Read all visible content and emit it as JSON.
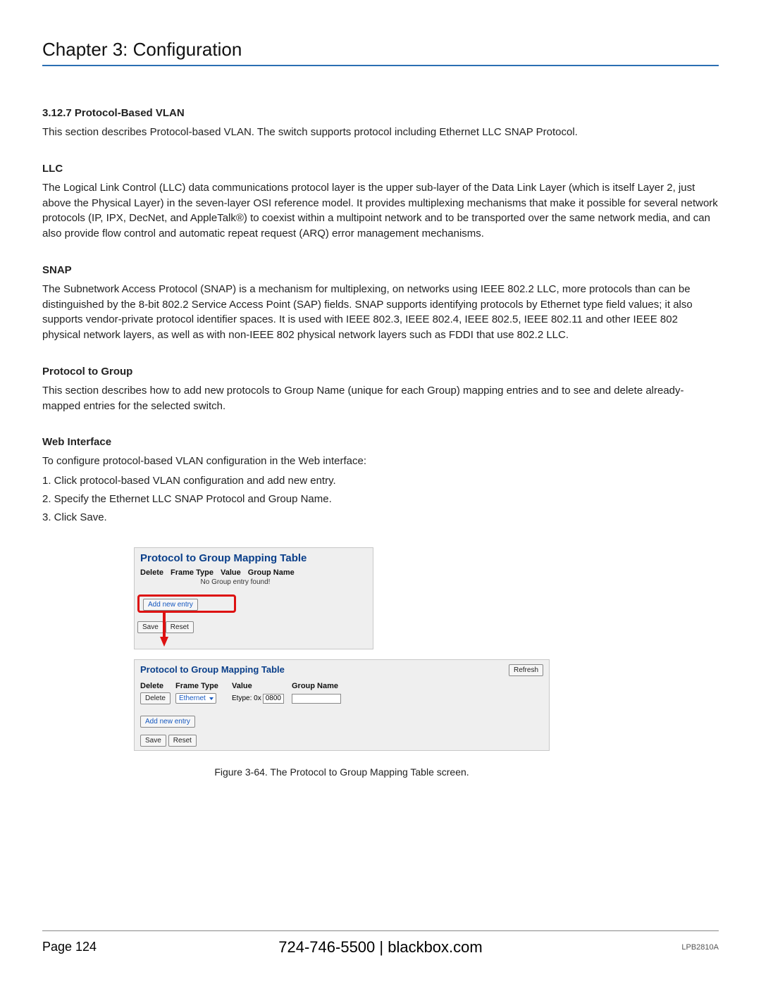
{
  "header": {
    "chapter_title": "Chapter 3: Configuration"
  },
  "s1": {
    "h": "3.12.7 Protocol-Based VLAN",
    "p": "This section describes Protocol-based VLAN. The switch supports protocol including Ethernet LLC SNAP Protocol."
  },
  "llc": {
    "h": "LLC",
    "p": "The Logical Link Control (LLC) data communications protocol layer is the upper sub-layer of the Data Link Layer (which is itself Layer 2, just above the Physical Layer) in the seven-layer OSI reference model. It provides multiplexing mechanisms that make it possible for several network protocols (IP, IPX, DecNet, and AppleTalk®) to coexist within a multipoint network and to be transported over the same network media, and can also provide flow control and automatic repeat request (ARQ) error management mechanisms."
  },
  "snap": {
    "h": "SNAP",
    "p": "The Subnetwork Access Protocol (SNAP) is a mechanism for multiplexing, on networks using IEEE 802.2 LLC, more protocols than can be distinguished by the 8-bit 802.2 Service Access Point (SAP) fields. SNAP supports identifying protocols by Ethernet type field values; it also supports vendor-private protocol identifier spaces. It is used with IEEE 802.3, IEEE 802.4, IEEE 802.5, IEEE 802.11 and other IEEE 802 physical network layers, as well as with non-IEEE 802 physical network layers such as FDDI that use 802.2 LLC."
  },
  "ptg": {
    "h": "Protocol to Group",
    "p": "This section describes how to add new protocols to Group Name (unique for each Group) mapping entries and to see and delete already-mapped entries for the selected switch."
  },
  "web": {
    "h": "Web Interface",
    "intro": "To configure protocol-based VLAN configuration in the Web interface:",
    "steps": [
      "1. Click protocol-based VLAN configuration and add new entry.",
      "2. Specify the Ethernet LLC SNAP Protocol and Group Name.",
      "3. Click Save."
    ]
  },
  "shot1": {
    "title": "Protocol to Group Mapping Table",
    "cols": [
      "Delete",
      "Frame Type",
      "Value",
      "Group Name"
    ],
    "empty": "No Group entry found!",
    "add": "Add new entry",
    "save": "Save",
    "reset": "Reset"
  },
  "shot2": {
    "title": "Protocol to Group Mapping Table",
    "refresh": "Refresh",
    "cols": [
      "Delete",
      "Frame Type",
      "Value",
      "Group Name"
    ],
    "row": {
      "delete_btn": "Delete",
      "frame_type": "Ethernet",
      "etype_prefix": "Etype: 0x",
      "etype_val": "0800",
      "group_name": ""
    },
    "add": "Add new entry",
    "save": "Save",
    "reset": "Reset"
  },
  "figure_caption": "Figure 3-64. The Protocol to Group Mapping Table screen.",
  "footer": {
    "page": "Page 124",
    "center": "724-746-5500   |   blackbox.com",
    "model": "LPB2810A"
  }
}
